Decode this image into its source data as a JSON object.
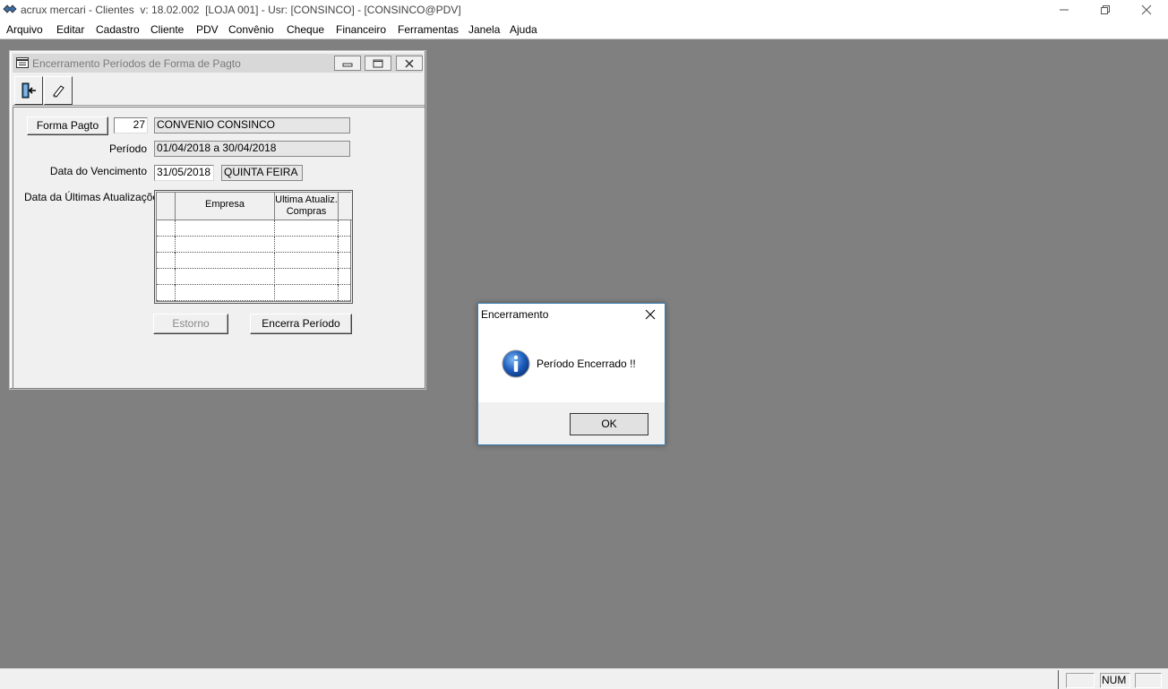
{
  "app": {
    "title": "acrux mercari - Clientes  v: 18.02.002  [LOJA 001] - Usr: [CONSINCO] - [CONSINCO@PDV]"
  },
  "menu": {
    "items": [
      "Arquivo",
      "Editar",
      "Cadastro",
      "Cliente",
      "PDV",
      "Convênio",
      "Cheque",
      "Financeiro",
      "Ferramentas",
      "Janela",
      "Ajuda"
    ]
  },
  "child_window": {
    "title": "Encerramento Períodos de Forma de Pagto",
    "forma_pagto_button": "Forma Pagto",
    "forma_pagto_code": "27",
    "forma_pagto_name": "CONVENIO CONSINCO",
    "periodo_label": "Período",
    "periodo_value": "01/04/2018  a  30/04/2018",
    "vencimento_label": "Data do Vencimento",
    "vencimento_date": "31/05/2018",
    "vencimento_day": "QUINTA FEIRA",
    "ultimas_label": "Data da Últimas Atualizações",
    "grid": {
      "col_empresa": "Empresa",
      "col_ultima_line1": "Ultima Atualiz.",
      "col_ultima_line2": "Compras",
      "rows": 5
    },
    "estorno_button": "Estorno",
    "encerra_button": "Encerra Período"
  },
  "dialog": {
    "title": "Encerramento",
    "message": "Período Encerrado !!",
    "ok_label": "OK"
  },
  "status": {
    "num": "NUM"
  }
}
